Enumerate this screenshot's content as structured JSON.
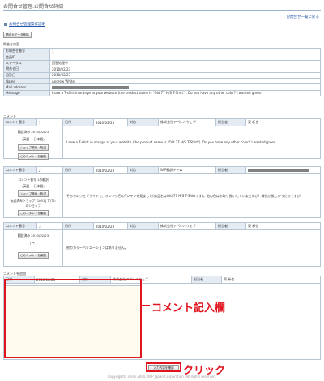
{
  "header": {
    "title": "お問合せ管理:お問合せ詳細",
    "top_link": "お問合せ一覧に戻る",
    "manual_link": "お問合せ管理操作説明",
    "delete_button": "問合せデータ削除"
  },
  "inquiry": {
    "section_label": "問合せ内容",
    "rows": [
      {
        "key": "お問合せ番号",
        "value": "1"
      },
      {
        "key": "会員ID",
        "value": ""
      },
      {
        "key": "ステータス",
        "value": "回答処理中"
      },
      {
        "key": "問合せ日",
        "value": "2010/02/23"
      },
      {
        "key": "回答日",
        "value": "2010/02/23"
      },
      {
        "key": "Name",
        "value": "Andrew White"
      },
      {
        "key": "Mail address",
        "value": ""
      },
      {
        "key": "Message",
        "value": "I saw a T-shirt in orange at your website (the product name is \"Old 77 H/S T-Shirt\"). Do you have any other color? I wanted green."
      }
    ]
  },
  "comments": {
    "section_label": "コメント",
    "labels": {
      "number": "コメント番号",
      "date": "日付",
      "handler": "対応",
      "person": "担当者"
    },
    "items": [
      {
        "number": "1",
        "date": "2010/02/23",
        "handler": "株式会社アパレルウェブ",
        "person": "東 新也",
        "status": "翻訳済み 2010/02/23",
        "direction": "(英語 → 日本語)",
        "product_button": "ショップ検索・転送",
        "forward_note": "",
        "edit_button": "このコメントを編集",
        "body": "I saw a T-shirt in orange at your website (the product name is \"Old 77 H/S T-Shirt\"). Do you have any other color? I wanted green."
      },
      {
        "number": "2",
        "date": "2010/02/23",
        "handler": "WIP翻訳チーム",
        "person": "",
        "status": "コメント番号 1の翻訳",
        "direction": "(英語 → 日本語)",
        "product_button": "ショップ検索・転送",
        "forward_note": "転送済みショップ [1001] アパレルショップ",
        "edit_button": "このコメントを編集",
        "body": "そちらのウェブサイトで、オレンジ色のTシャツを見ました(商品名はOld 77 H/S T-Shirtです)。他の色はお取り扱いしていませんか？緑色が欲しかったのですが。"
      },
      {
        "number": "3",
        "date": "2010/02/23",
        "handler": "株式会社アパレルウェブ",
        "person": "東 新也",
        "status": "翻訳済み 2010/02/23",
        "direction": "( → )",
        "product_button": "",
        "forward_note": "",
        "edit_button": "このコメントを編集",
        "body": "他のカラーバリエーションはありません。"
      }
    ]
  },
  "new_comment": {
    "section_label": "コメントを追加",
    "date_label": "日付",
    "date_value": "2010/02/23",
    "handler_label": "対応",
    "handler_value": "株式会社アパレルウェブ",
    "person_label": "担当者",
    "person_value": "東 新也",
    "confirm_button": "入力内容を確認"
  },
  "annotations": {
    "comment_field": "コメント記入欄",
    "click": "クリック",
    "color": "#e0141e"
  },
  "footer": {
    "copyright": "Copyright© since 2000, WIP Japan Corporation. All rights reserved."
  }
}
